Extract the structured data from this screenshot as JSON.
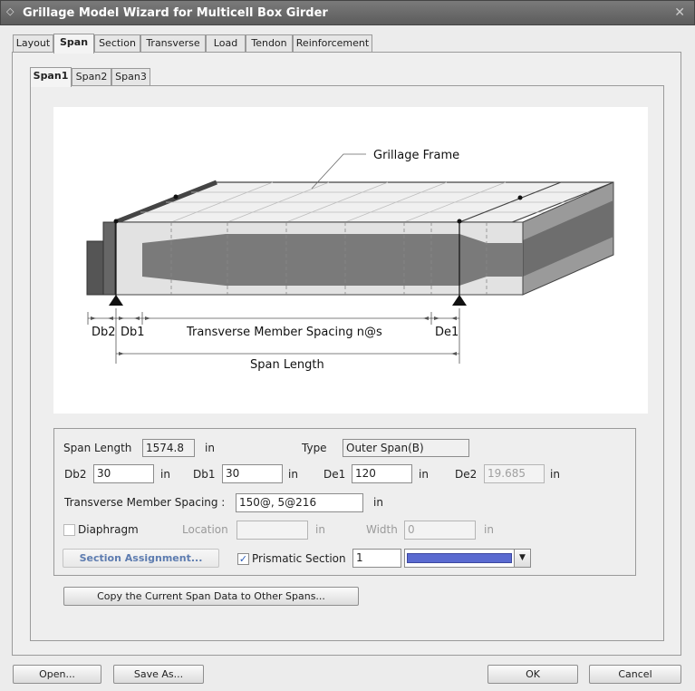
{
  "window": {
    "title": "Grillage Model Wizard for Multicell Box Girder"
  },
  "tabs": [
    "Layout",
    "Span",
    "Section",
    "Transverse",
    "Load",
    "Tendon",
    "Reinforcement"
  ],
  "subtabs": [
    "Span1",
    "Span2",
    "Span3"
  ],
  "diagram": {
    "grillage_frame": "Grillage Frame",
    "db2": "Db2",
    "db1": "Db1",
    "transverse_spacing": "Transverse Member Spacing n@s",
    "de1": "De1",
    "span_length": "Span Length"
  },
  "form": {
    "span_length_label": "Span Length",
    "span_length_value": "1574.8",
    "span_length_unit": "in",
    "type_label": "Type",
    "type_value": "Outer Span(B)",
    "db2_label": "Db2",
    "db2_value": "30",
    "db1_label": "Db1",
    "db1_value": "30",
    "de1_label": "De1",
    "de1_value": "120",
    "de2_label": "De2",
    "de2_value": "19.685",
    "unit_in": "in",
    "tms_label": "Transverse Member Spacing :",
    "tms_value": "150@, 5@216",
    "diaphragm_label": "Diaphragm",
    "location_label": "Location",
    "location_value": "",
    "width_label": "Width",
    "width_value": "0",
    "section_assignment_btn": "Section Assignment...",
    "prismatic_label": "Prismatic Section",
    "prismatic_value": "1",
    "prismatic_checked": "✓",
    "color_swatch": "#5a6ad0"
  },
  "copy_btn": "Copy the Current Span Data to Other Spans...",
  "footer": {
    "open": "Open...",
    "save_as": "Save As...",
    "ok": "OK",
    "cancel": "Cancel"
  }
}
